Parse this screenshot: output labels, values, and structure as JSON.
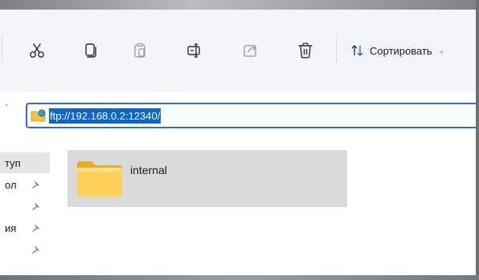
{
  "toolbar": {
    "items": [
      {
        "name": "cut",
        "icon": "scissors-icon",
        "enabled": true
      },
      {
        "name": "copy",
        "icon": "copy-icon",
        "enabled": true
      },
      {
        "name": "paste",
        "icon": "paste-icon",
        "enabled": false
      },
      {
        "name": "rename",
        "icon": "rename-icon",
        "enabled": true
      },
      {
        "name": "share",
        "icon": "share-icon",
        "enabled": false
      },
      {
        "name": "delete",
        "icon": "trash-icon",
        "enabled": true
      }
    ],
    "sort_label": "Сортировать",
    "sort_chevron": "⌄"
  },
  "address_bar": {
    "back_glyph": "ˋ",
    "value": "ftp://192.168.0.2:12340/",
    "icon": "ftp-location-icon",
    "selected": true
  },
  "nav_pane": {
    "items": [
      {
        "label": "туп",
        "selected": true,
        "pinned": false
      },
      {
        "label": "ол",
        "selected": false,
        "pinned": true
      },
      {
        "label": "",
        "selected": false,
        "pinned": true
      },
      {
        "label": "ия",
        "selected": false,
        "pinned": true
      },
      {
        "label": "",
        "selected": false,
        "pinned": true
      }
    ]
  },
  "content": {
    "items": [
      {
        "name": "internal",
        "type": "folder",
        "selected": true
      }
    ]
  },
  "colors": {
    "accent": "#0a64d6",
    "address_border": "#2a6fd1",
    "selection_bg": "#dadada",
    "folder_yellow": "#f7c948"
  }
}
